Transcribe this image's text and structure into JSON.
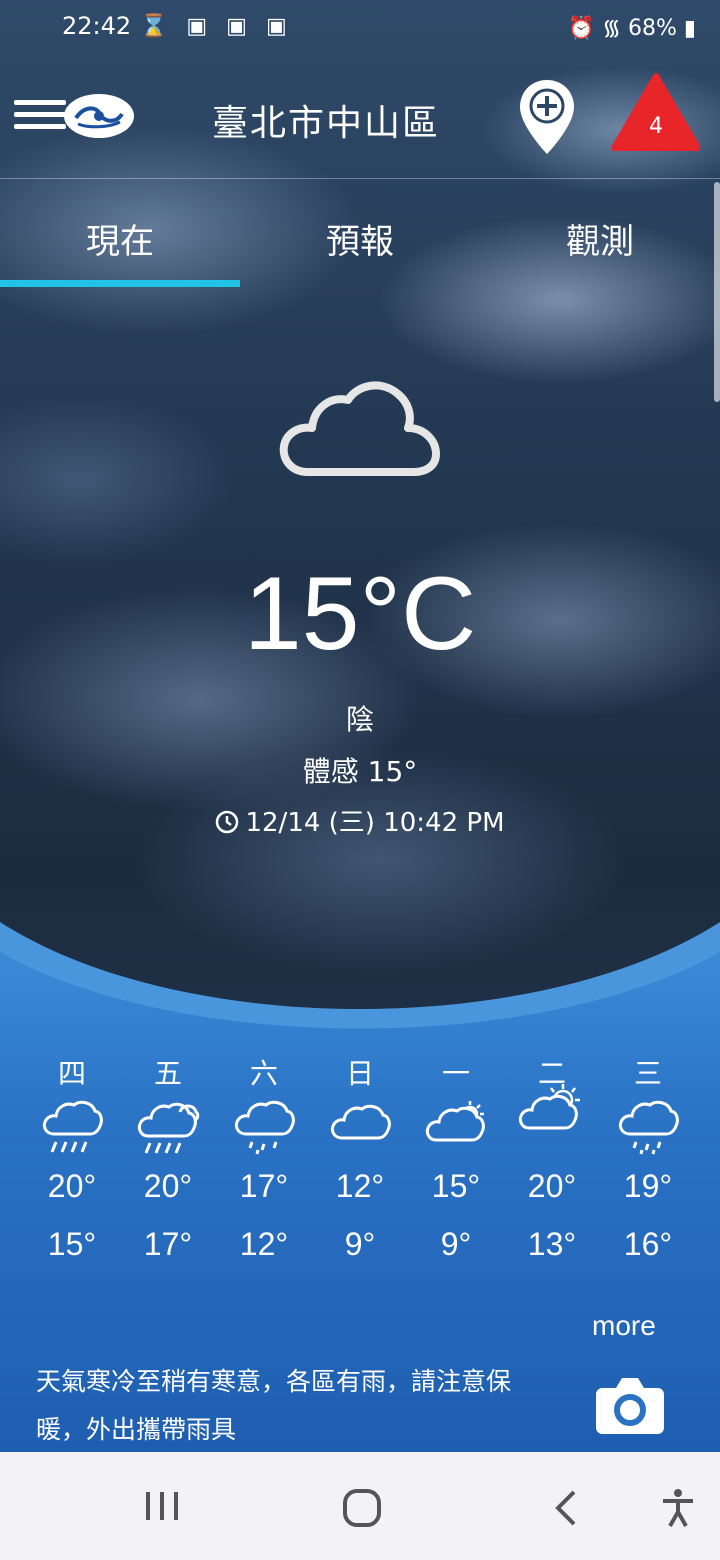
{
  "status_bar": {
    "time": "22:42",
    "battery": "68%"
  },
  "header": {
    "location": "臺北市中山區",
    "alert_count": "4"
  },
  "tabs": [
    {
      "label": "現在",
      "active": true
    },
    {
      "label": "預報",
      "active": false
    },
    {
      "label": "觀測",
      "active": false
    }
  ],
  "current": {
    "icon": "cloud-icon",
    "temperature": "15°C",
    "condition": "陰",
    "feels_like": "體感 15°",
    "updated": "12/14 (三) 10:42 PM"
  },
  "forecast": [
    {
      "day": "四",
      "icon": "rain-icon",
      "high": "20°",
      "low": "15°"
    },
    {
      "day": "五",
      "icon": "rain-cloud-icon",
      "high": "20°",
      "low": "17°"
    },
    {
      "day": "六",
      "icon": "light-rain-icon",
      "high": "17°",
      "low": "12°"
    },
    {
      "day": "日",
      "icon": "cloud-icon",
      "high": "12°",
      "low": "9°"
    },
    {
      "day": "一",
      "icon": "partly-cloudy-icon",
      "high": "15°",
      "low": "9°"
    },
    {
      "day": "二",
      "icon": "partly-sunny-icon",
      "high": "20°",
      "low": "13°"
    },
    {
      "day": "三",
      "icon": "light-rain-icon",
      "high": "19°",
      "low": "16°"
    }
  ],
  "more_label": "more",
  "summary": "天氣寒冷至稍有寒意，各區有雨，請注意保暖，外出攜帶雨具",
  "colors": {
    "tab_indicator": "#22c4e6",
    "alert": "#e8262a",
    "wave": "#2a78c8"
  }
}
